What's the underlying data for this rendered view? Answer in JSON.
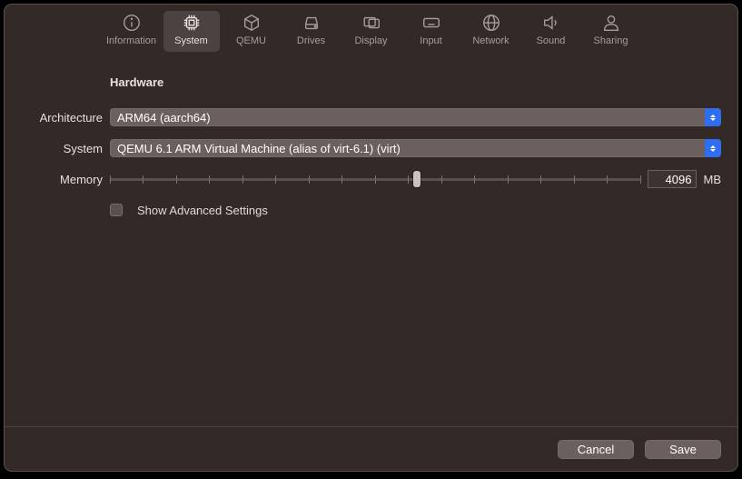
{
  "tabs": {
    "information": "Information",
    "system": "System",
    "qemu": "QEMU",
    "drives": "Drives",
    "display": "Display",
    "input": "Input",
    "network": "Network",
    "sound": "Sound",
    "sharing": "Sharing"
  },
  "hardware": {
    "heading": "Hardware",
    "architecture_label": "Architecture",
    "architecture_value": "ARM64 (aarch64)",
    "system_label": "System",
    "system_value": "QEMU 6.1 ARM Virtual Machine (alias of virt-6.1) (virt)",
    "memory_label": "Memory",
    "memory_value": "4096",
    "memory_unit": "MB",
    "memory_slider_percent": 58,
    "advanced_label": "Show Advanced Settings"
  },
  "footer": {
    "cancel": "Cancel",
    "save": "Save"
  }
}
